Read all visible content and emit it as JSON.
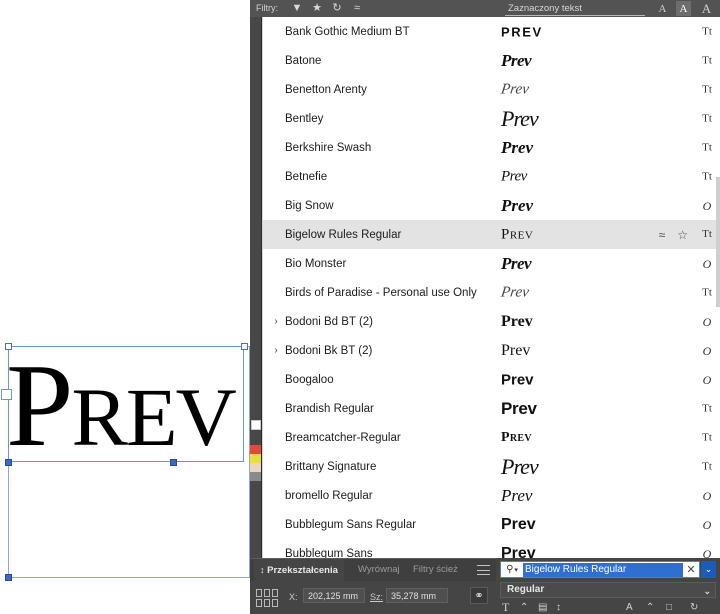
{
  "app": {
    "canvas": {
      "artwork_text": "Prev",
      "artwork_display": "Prev"
    },
    "top_bar": {
      "filter_label": "Filtry:",
      "style_field_value": "Zaznaczony tekst",
      "icons": [
        {
          "name": "filter-funnel-icon",
          "glyph": "▼"
        },
        {
          "name": "star-filled-icon",
          "glyph": "★"
        },
        {
          "name": "clock-history-icon",
          "glyph": "↻"
        },
        {
          "name": "similar-wave-icon",
          "glyph": "≈"
        }
      ],
      "caps_buttons": [
        {
          "name": "caps-size-small",
          "label": "A",
          "active": false
        },
        {
          "name": "caps-size-medium",
          "label": "A",
          "active": true
        },
        {
          "name": "caps-size-large",
          "label": "A",
          "active": false
        }
      ]
    },
    "font_list": {
      "rows": [
        {
          "name": "Bank Gothic Medium BT",
          "preview": "Prev",
          "preview_class": "p-bankgothic",
          "type_icon": "Tt",
          "expandable": false,
          "selected": false
        },
        {
          "name": "Batone",
          "preview": "Prev",
          "preview_class": "p-script-b",
          "type_icon": "Tt",
          "expandable": false,
          "selected": false
        },
        {
          "name": "Benetton Arenty",
          "preview": "Prev",
          "preview_class": "p-script-thin",
          "type_icon": "Tt",
          "expandable": false,
          "selected": false
        },
        {
          "name": "Bentley",
          "preview": "Prev",
          "preview_class": "p-script-tall",
          "type_icon": "Tt",
          "expandable": false,
          "selected": false
        },
        {
          "name": "Berkshire Swash",
          "preview": "Prev",
          "preview_class": "p-swash",
          "type_icon": "Tt",
          "expandable": false,
          "selected": false
        },
        {
          "name": "Betnefie",
          "preview": "Prev",
          "preview_class": "p-betnefie",
          "type_icon": "Tt",
          "expandable": false,
          "selected": false
        },
        {
          "name": "Big Snow",
          "preview": "Prev",
          "preview_class": "p-bigsnow",
          "type_icon": "O",
          "expandable": false,
          "selected": false
        },
        {
          "name": "Bigelow Rules Regular",
          "preview": "Prev",
          "preview_class": "p-smallcaps",
          "type_icon": "Tt",
          "expandable": false,
          "selected": true
        },
        {
          "name": "Bio Monster",
          "preview": "Prev",
          "preview_class": "p-script-b",
          "type_icon": "O",
          "expandable": false,
          "selected": false
        },
        {
          "name": "Birds of Paradise - Personal use Only",
          "preview": "Prev",
          "preview_class": "p-script-thin",
          "type_icon": "Tt",
          "expandable": false,
          "selected": false
        },
        {
          "name": "Bodoni Bd BT (2)",
          "preview": "Prev",
          "preview_class": "p-bodoni",
          "type_icon": "O",
          "expandable": true,
          "selected": false
        },
        {
          "name": "Bodoni Bk BT (2)",
          "preview": "Prev",
          "preview_class": "p-bodoni-bk",
          "type_icon": "O",
          "expandable": true,
          "selected": false
        },
        {
          "name": "Boogaloo",
          "preview": "Prev",
          "preview_class": "p-boogaloo",
          "type_icon": "O",
          "expandable": false,
          "selected": false
        },
        {
          "name": "Brandish Regular",
          "preview": "Prev",
          "preview_class": "p-brandish",
          "type_icon": "Tt",
          "expandable": false,
          "selected": false
        },
        {
          "name": "Breamcatcher-Regular",
          "preview": "Prev",
          "preview_class": "p-bream",
          "type_icon": "Tt",
          "expandable": false,
          "selected": false
        },
        {
          "name": "Brittany Signature",
          "preview": "Prev",
          "preview_class": "p-script-tall",
          "type_icon": "Tt",
          "expandable": false,
          "selected": false
        },
        {
          "name": "bromello Regular",
          "preview": "Prev",
          "preview_class": "p-bromello",
          "type_icon": "O",
          "expandable": false,
          "selected": false
        },
        {
          "name": "Bubblegum Sans Regular",
          "preview": "Prev",
          "preview_class": "p-bubble",
          "type_icon": "O",
          "expandable": false,
          "selected": false
        },
        {
          "name": "Bubblegum Sans",
          "preview": "Prev",
          "preview_class": "p-bubble",
          "type_icon": "O",
          "expandable": false,
          "selected": false
        }
      ],
      "selected_row_actions": {
        "similar_icon": "≈",
        "favorite_icon": "☆"
      }
    },
    "bottom_left_panel": {
      "tabs": [
        {
          "name": "tab-przeksztalcenia",
          "label": "Przekształcenia",
          "active": true
        },
        {
          "name": "tab-wyrownaj",
          "label": "Wyrównaj",
          "active": false
        },
        {
          "name": "tab-filtry-sciez",
          "label": "Filtry ścież",
          "active": false
        }
      ],
      "x_label": "X:",
      "x_value": "202,125 mm",
      "size_label": "Sz:",
      "size_value": "35,278 mm",
      "lock_icon": "⚭"
    },
    "bottom_right_panel": {
      "search_value": "Bigelow Rules Regular",
      "search_clear_icon": "✕",
      "search_caret_icon": "⌄",
      "style_value": "Regular",
      "style_caret_icon": "⌄",
      "tools": [
        {
          "name": "text-tool-icon",
          "glyph": "T"
        },
        {
          "name": "size-stepper-icon",
          "glyph": "⌃"
        },
        {
          "name": "leading-icon",
          "glyph": "▤"
        },
        {
          "name": "baseline-icon",
          "glyph": "↕"
        },
        {
          "name": "kerning-icon",
          "glyph": "A"
        },
        {
          "name": "tracking-icon",
          "glyph": "⌃"
        },
        {
          "name": "vertical-scale-icon",
          "glyph": "□"
        },
        {
          "name": "rotate-glyph-icon",
          "glyph": "↻"
        }
      ]
    },
    "colors": {
      "panel_bg": "#454545",
      "list_bg": "#ffffff",
      "selected_row": "#e3e3e3",
      "accent_blue": "#2f6fd0",
      "selection_outline": "#6f93de"
    }
  }
}
